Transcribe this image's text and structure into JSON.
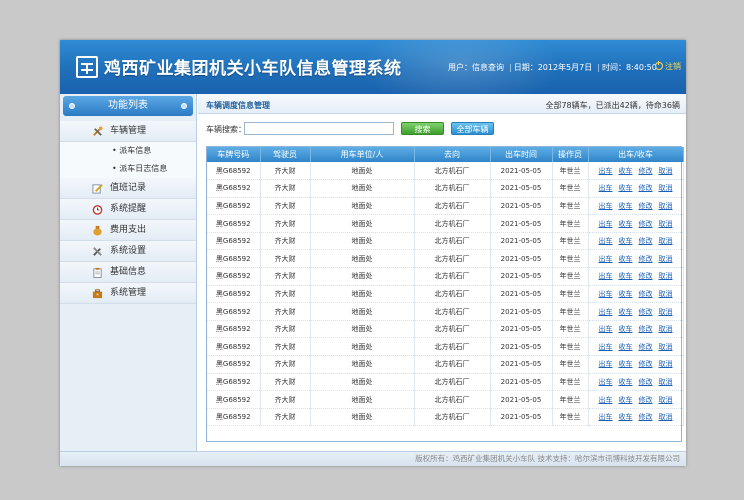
{
  "app": {
    "title": "鸡西矿业集团机关小车队信息管理系统",
    "user_label": "用户：信息查询",
    "date_label": "日期：2012年5月7日",
    "time_label": "时间：8:40:50",
    "logout_label": "注销"
  },
  "sidebar": {
    "header": "功能列表",
    "items": [
      {
        "label": "车辆管理",
        "icon": "tools-icon"
      },
      {
        "label": "值班记录",
        "icon": "edit-icon"
      },
      {
        "label": "系统提醒",
        "icon": "alarm-clock-icon"
      },
      {
        "label": "费用支出",
        "icon": "money-bag-icon"
      },
      {
        "label": "系统设置",
        "icon": "wrench-icon"
      },
      {
        "label": "基础信息",
        "icon": "clipboard-icon"
      },
      {
        "label": "系统管理",
        "icon": "toolbox-icon"
      }
    ],
    "subitems": [
      "派车信息",
      "派车日志信息"
    ]
  },
  "main": {
    "breadcrumb": "车辆调度信息管理",
    "summary": "全部78辆车，已派出42辆，待命36辆",
    "search_label": "车辆搜索：",
    "search_value": "",
    "search_button": "搜索",
    "all_button": "全部车辆"
  },
  "table": {
    "headers": [
      "车牌号码",
      "驾驶员",
      "用车单位/人",
      "去向",
      "出车时间",
      "操作员",
      "出车/收车"
    ],
    "actions": [
      "出车",
      "收车",
      "修改",
      "取消"
    ],
    "rows": [
      [
        "黑G68592",
        "齐大财",
        "地面处",
        "北方机石厂",
        "2021-05-05",
        "年世兰"
      ],
      [
        "黑G68592",
        "齐大财",
        "地面处",
        "北方机石厂",
        "2021-05-05",
        "年世兰"
      ],
      [
        "黑G68592",
        "齐大财",
        "地面处",
        "北方机石厂",
        "2021-05-05",
        "年世兰"
      ],
      [
        "黑G68592",
        "齐大财",
        "地面处",
        "北方机石厂",
        "2021-05-05",
        "年世兰"
      ],
      [
        "黑G68592",
        "齐大财",
        "地面处",
        "北方机石厂",
        "2021-05-05",
        "年世兰"
      ],
      [
        "黑G68592",
        "齐大财",
        "地面处",
        "北方机石厂",
        "2021-05-05",
        "年世兰"
      ],
      [
        "黑G68592",
        "齐大财",
        "地面处",
        "北方机石厂",
        "2021-05-05",
        "年世兰"
      ],
      [
        "黑G68592",
        "齐大财",
        "地面处",
        "北方机石厂",
        "2021-05-05",
        "年世兰"
      ],
      [
        "黑G68592",
        "齐大财",
        "地面处",
        "北方机石厂",
        "2021-05-05",
        "年世兰"
      ],
      [
        "黑G68592",
        "齐大财",
        "地面处",
        "北方机石厂",
        "2021-05-05",
        "年世兰"
      ],
      [
        "黑G68592",
        "齐大财",
        "地面处",
        "北方机石厂",
        "2021-05-05",
        "年世兰"
      ],
      [
        "黑G68592",
        "齐大财",
        "地面处",
        "北方机石厂",
        "2021-05-05",
        "年世兰"
      ],
      [
        "黑G68592",
        "齐大财",
        "地面处",
        "北方机石厂",
        "2021-05-05",
        "年世兰"
      ],
      [
        "黑G68592",
        "齐大财",
        "地面处",
        "北方机石厂",
        "2021-05-05",
        "年世兰"
      ],
      [
        "黑G68592",
        "齐大财",
        "地面处",
        "北方机石厂",
        "2021-05-05",
        "年世兰"
      ]
    ]
  },
  "footer": {
    "text": "版权所有：鸡西矿业集团机关小车队  技术支持：哈尔滨市讯博科技开发有限公司"
  },
  "colors": {
    "header_blue": "#2f8cd4",
    "link_blue": "#1c5fb5",
    "search_green": "#3f9d2f",
    "logout_yellow": "#ffd84a"
  }
}
